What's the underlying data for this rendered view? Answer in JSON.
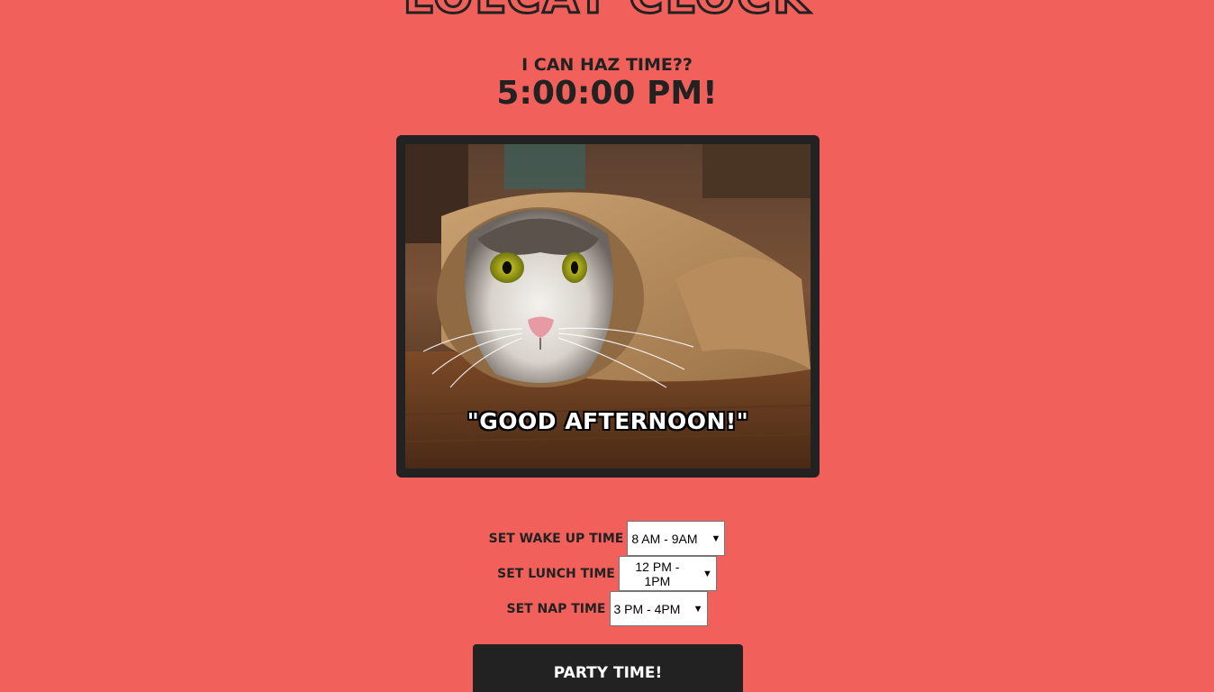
{
  "app": {
    "title": "LOLCAT CLOCK",
    "subtitle": "I CAN HAZ TIME??",
    "time": "5:00:00 PM!"
  },
  "image": {
    "caption": "\"GOOD AFTERNOON!\""
  },
  "settings": {
    "wake_label": "SET WAKE UP TIME",
    "wake_value": "8 AM - 9AM",
    "lunch_label": "SET LUNCH TIME",
    "lunch_value": "12 PM - 1PM",
    "nap_label": "SET NAP TIME",
    "nap_value": "3 PM - 4PM"
  },
  "actions": {
    "party_label": "PARTY TIME!"
  },
  "colors": {
    "background": "#f1605a",
    "dark": "#222222"
  }
}
